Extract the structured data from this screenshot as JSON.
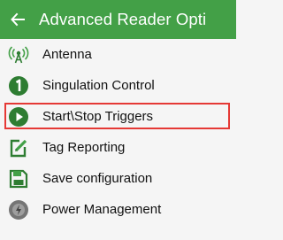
{
  "appbar": {
    "title": "Advanced Reader Opti",
    "back_icon": "arrow-left-icon",
    "background": "#43a047"
  },
  "menu": {
    "items": [
      {
        "label": "Antenna",
        "icon": "antenna-icon"
      },
      {
        "label": "Singulation Control",
        "icon": "number-one-circle-icon"
      },
      {
        "label": "Start\\Stop Triggers",
        "icon": "play-circle-icon",
        "selected": true
      },
      {
        "label": "Tag Reporting",
        "icon": "edit-note-icon"
      },
      {
        "label": "Save configuration",
        "icon": "save-floppy-icon"
      },
      {
        "label": "Power Management",
        "icon": "power-management-icon"
      }
    ]
  },
  "colors": {
    "accent": "#43a047",
    "icon_dark": "#2e7d32",
    "highlight": "#e53935"
  }
}
